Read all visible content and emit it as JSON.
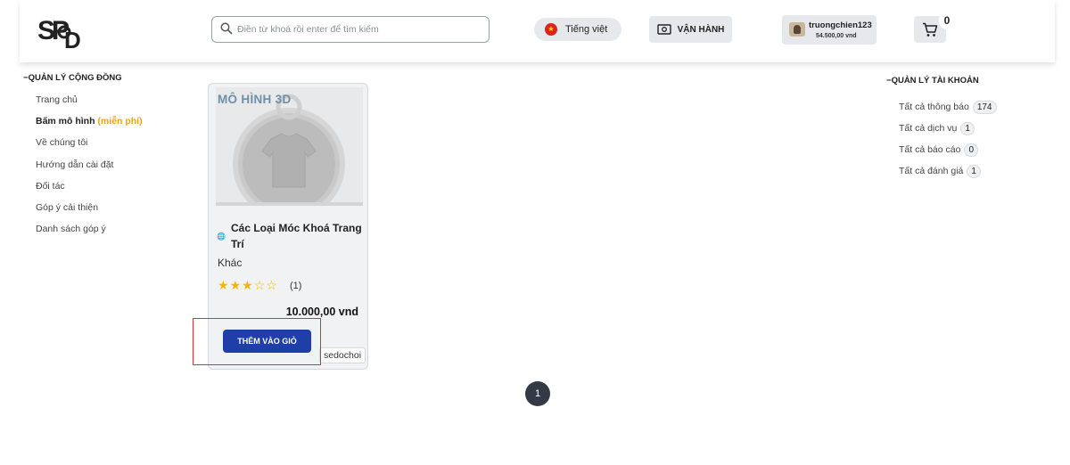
{
  "header": {
    "logo_text": "SP&D",
    "search_placeholder": "Điền từ khoá rồi enter để tìm kiếm",
    "language_label": "Tiếng việt",
    "operations_label": "VẬN HÀNH",
    "username": "truongchien123",
    "balance": "54.500,00 vnd",
    "cart_count": "0"
  },
  "left_sidebar": {
    "title": "QUẢN LÝ CỘNG ĐỒNG",
    "items": [
      {
        "label": "Trang chủ"
      },
      {
        "label": "Bấm mô hình",
        "suffix": "(miễn phí)"
      },
      {
        "label": "Về chúng tôi"
      },
      {
        "label": "Hướng dẫn cài đặt"
      },
      {
        "label": "Đối tác"
      },
      {
        "label": "Góp ý cải thiện"
      },
      {
        "label": "Danh sách góp ý"
      }
    ]
  },
  "right_sidebar": {
    "title": "QUẢN LÝ TÀI KHOẢN",
    "items": [
      {
        "label": "Tất cả thông báo",
        "count": "174"
      },
      {
        "label": "Tất cả dịch vụ",
        "count": "1"
      },
      {
        "label": "Tất cả báo cáo",
        "count": "0"
      },
      {
        "label": "Tất cả đánh giá",
        "count": "1"
      }
    ]
  },
  "product": {
    "image_tag": "MÔ HÌNH 3D",
    "title": "Các Loại Móc Khoá Trang Trí",
    "category": "Khác",
    "rating": 3,
    "rating_max": 5,
    "rating_count": "(1)",
    "price": "10.000,00 vnd",
    "add_to_cart_label": "THÊM VÀO GIỎ",
    "seller": "sedochoi"
  },
  "pagination": {
    "current_page": "1"
  },
  "colors": {
    "primary_button": "#1e3ea8",
    "star": "#f4b400",
    "free_text": "#f0a11b",
    "highlight_box": "#e03131",
    "pagination_active": "#333a45"
  }
}
